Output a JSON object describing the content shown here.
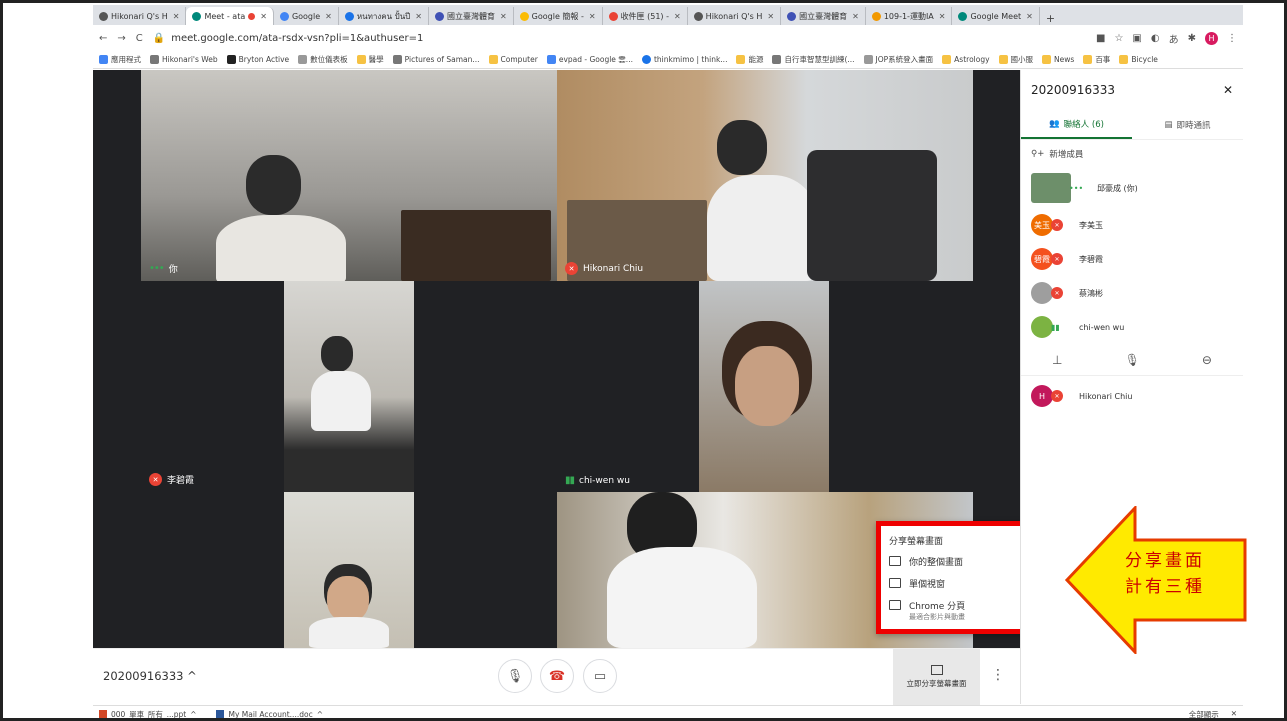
{
  "tabs": [
    {
      "title": "Hikonari Q's H",
      "color": "#555",
      "active": false
    },
    {
      "title": "Meet - ata",
      "color": "#00897b",
      "active": true
    },
    {
      "title": "Google",
      "color": "#4285f4",
      "active": false
    },
    {
      "title": "หนทางคน ปั้นปี",
      "color": "#1a73e8",
      "active": false
    },
    {
      "title": "國立臺灣體育",
      "color": "#3f51b5",
      "active": false
    },
    {
      "title": "Google 簡報 -",
      "color": "#fbbc04",
      "active": false
    },
    {
      "title": "收件匣 (51) -",
      "color": "#ea4335",
      "active": false
    },
    {
      "title": "Hikonari Q's H",
      "color": "#555",
      "active": false
    },
    {
      "title": "國立臺灣體育",
      "color": "#3f51b5",
      "active": false
    },
    {
      "title": "109-1-運動IA",
      "color": "#f29900",
      "active": false
    },
    {
      "title": "Google Meet",
      "color": "#00897b",
      "active": false
    }
  ],
  "address": {
    "url": "meet.google.com/ata-rsdx-vsn?pli=1&authuser=1",
    "nav": [
      "←",
      "→",
      "C"
    ],
    "profile_initial": "H"
  },
  "bookmarks": [
    "應用程式",
    "Hikonari's Web",
    "Bryton Active",
    "數位儀表板",
    "醫學",
    "Pictures of Saman...",
    "Computer",
    "evpad - Google 雲...",
    "thinkmimo | think...",
    "能源",
    "自行車智慧型訓練(...",
    "JOP系統登入畫面",
    "Astrology",
    "國小服",
    "News",
    "百事",
    "Bicycle"
  ],
  "tiles": [
    {
      "name": "你",
      "bg": "#8a8f94"
    },
    {
      "name": "Hikonari Chiu",
      "bg": "#a48a6a"
    },
    {
      "name": "李碧霞",
      "bg": "#b9b4ab"
    },
    {
      "name": "chi-wen wu",
      "bg": "#8a7a6a"
    },
    {
      "name": "",
      "bg": "#c9c4b8"
    },
    {
      "name": "",
      "bg": "#b2aa9c"
    }
  ],
  "popup": {
    "title": "分享螢幕畫面",
    "items": [
      {
        "label": "你的整個畫面",
        "sub": ""
      },
      {
        "label": "單個視窗",
        "sub": ""
      },
      {
        "label": "Chrome 分頁",
        "sub": "最適合影片與動畫"
      }
    ]
  },
  "bottom": {
    "meeting_code": "20200916333",
    "present_label": "立即分享螢幕畫面"
  },
  "panel": {
    "title": "20200916333",
    "tab_people": "聯絡人 (6)",
    "tab_chat": "即時通訊",
    "add_people": "新增成員",
    "participants": [
      {
        "name": "邱豪成 (你)",
        "initial": "",
        "color": "#6d8f6a",
        "muted": false
      },
      {
        "name": "李美玉",
        "initial": "美玉",
        "color": "#ef6c00",
        "muted": true
      },
      {
        "name": "李碧霞",
        "initial": "碧霞",
        "color": "#f4511e",
        "muted": true
      },
      {
        "name": "蔡鴻彬",
        "initial": "",
        "color": "#9e9e9e",
        "muted": true
      },
      {
        "name": "chi-wen wu",
        "initial": "",
        "color": "#7cb342",
        "muted": false
      },
      {
        "name": "Hikonari Chiu",
        "initial": "H",
        "color": "#c2185b",
        "muted": true
      }
    ]
  },
  "annotation": {
    "line1": "分享畫面",
    "line2": "計有三種"
  },
  "downloads": {
    "items": [
      "000_單車_所有_...ppt",
      "My Mail Account....doc"
    ],
    "show_all": "全部顯示",
    "close": "✕"
  }
}
